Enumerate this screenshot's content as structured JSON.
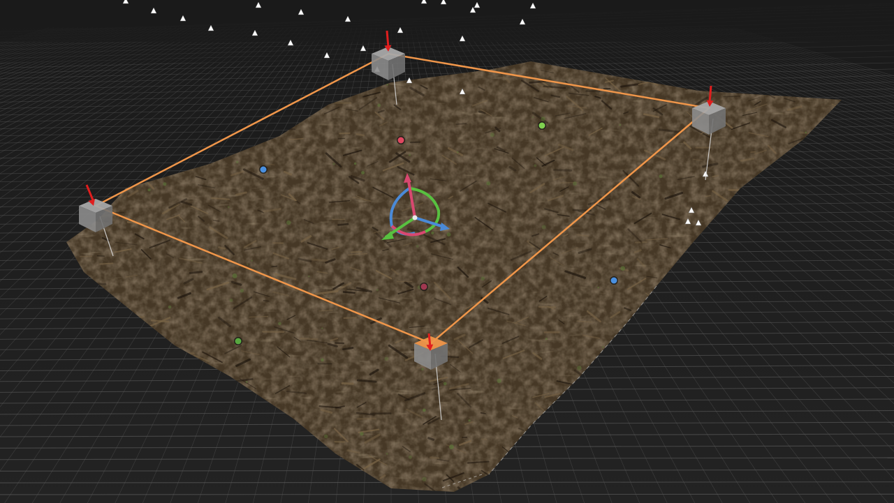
{
  "viewport": {
    "mode": "3d-scene-editor",
    "background_color": "#1c1c1c",
    "sky_color": "#1b1b1b",
    "grid": {
      "visible": true,
      "line_color": "#5a5a5a"
    }
  },
  "terrain": {
    "type": "photogrammetry-mesh",
    "description_visible": false,
    "base_color": "#4a3a28"
  },
  "bounding_box": {
    "color": "#f0964a",
    "corner_handle_color": "#8c8c8c",
    "selected_corner_color": "#f0964a",
    "corner_count": 4,
    "selected_corner": "front"
  },
  "height_arrows": {
    "color": "#e01e1e",
    "count": 4
  },
  "gizmo": {
    "axes": [
      {
        "axis": "x",
        "color": "#4a8ad8"
      },
      {
        "axis": "y",
        "color": "#58c040"
      },
      {
        "axis": "z",
        "color": "#d84870"
      }
    ]
  },
  "markers": [
    {
      "color": "#e04860"
    },
    {
      "color": "#80d050"
    },
    {
      "color": "#4a90e0"
    },
    {
      "color": "#4a90e0"
    },
    {
      "color": "#a03850"
    },
    {
      "color": "#58a840"
    }
  ],
  "camera_markers": {
    "color": "#ffffff",
    "count": 26
  }
}
